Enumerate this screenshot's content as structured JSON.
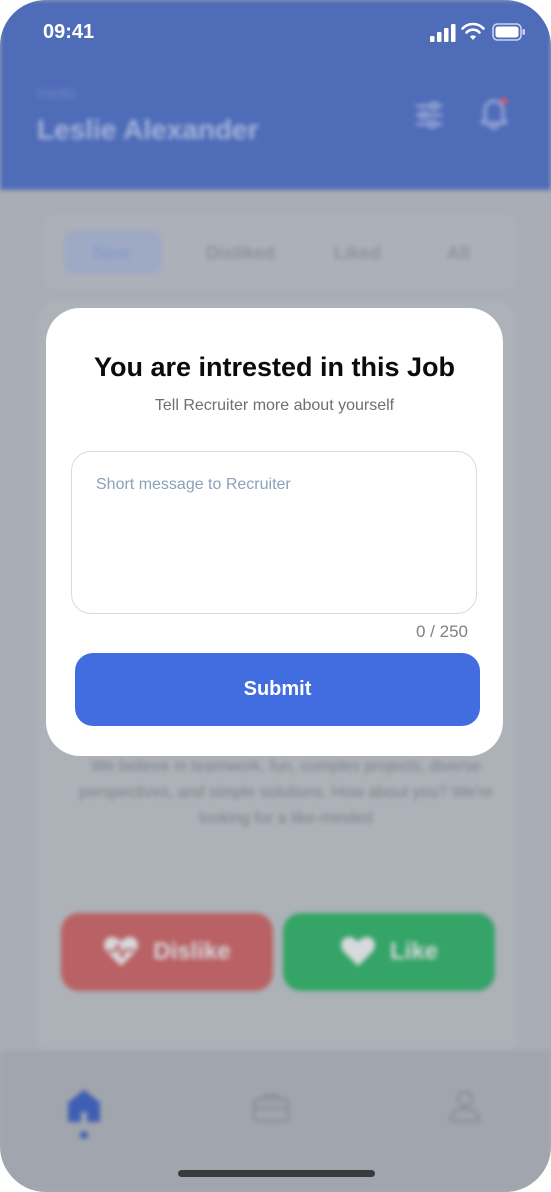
{
  "status_bar": {
    "time": "09:41"
  },
  "header": {
    "greeting": "Hello",
    "user_name": "Leslie Alexander",
    "icons": [
      "filter-icon",
      "bell-icon"
    ],
    "color": "#4e6cb8"
  },
  "tabs": [
    {
      "label": "New",
      "active": true
    },
    {
      "label": "Disliked",
      "active": false
    },
    {
      "label": "Liked",
      "active": false
    },
    {
      "label": "All",
      "active": false
    }
  ],
  "job": {
    "description": "We believe in teamwork, fun, complex projects, diverse perspectives, and simple solutions. How about you? We're looking for a like-minded"
  },
  "actions": {
    "dislike_label": "Dislike",
    "like_label": "Like",
    "dislike_color": "#b96164",
    "like_color": "#35a467"
  },
  "bottom_nav": {
    "items": [
      "home-icon",
      "jobs-icon",
      "profile-icon"
    ],
    "active": "home-icon"
  },
  "modal": {
    "title": "You are intrested in this Job",
    "subtitle": "Tell Recruiter more about yourself",
    "message_placeholder": "Short message to Recruiter",
    "message_value": "",
    "char_counter": "0 / 250",
    "submit_label": "Submit",
    "accent_color": "#426de0"
  }
}
